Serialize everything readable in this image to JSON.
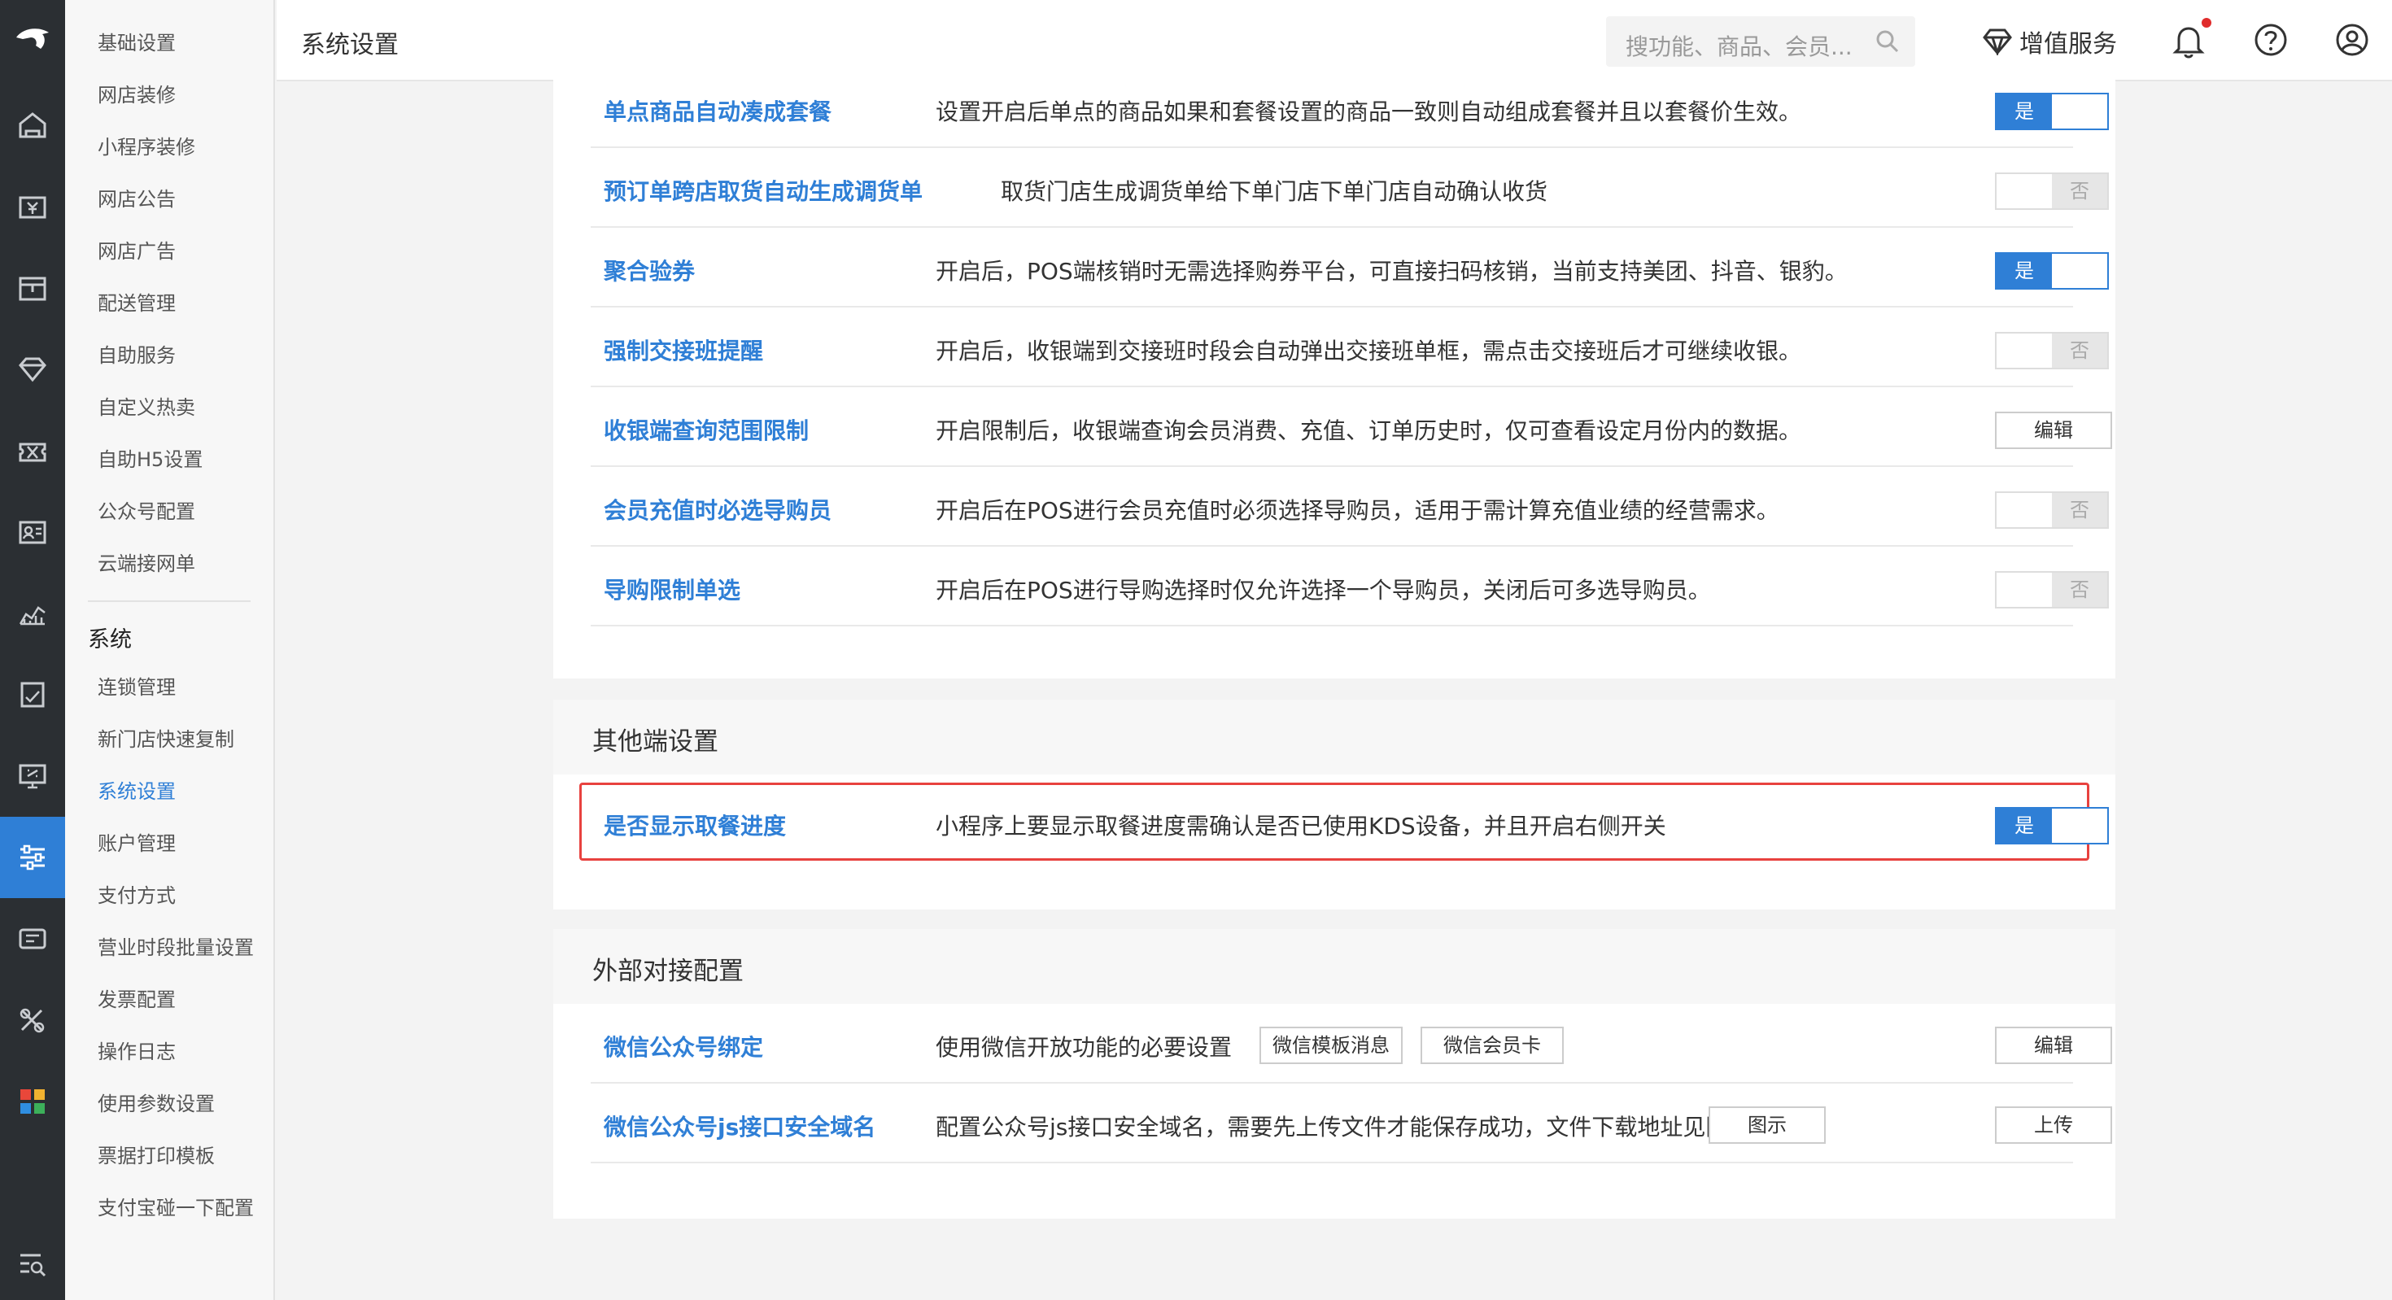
{
  "header": {
    "title": "系统设置",
    "search_placeholder": "搜功能、商品、会员...",
    "vip_label": "增值服务"
  },
  "submenu": {
    "items_top": [
      "基础设置",
      "网店装修",
      "小程序装修",
      "网店公告",
      "网店广告",
      "配送管理",
      "自助服务",
      "自定义热卖",
      "自助H5设置",
      "公众号配置",
      "云端接网单"
    ],
    "section_title": "系统",
    "items_bottom": [
      "连锁管理",
      "新门店快速复制",
      "系统设置",
      "账户管理",
      "支付方式",
      "营业时段批量设置",
      "发票配置",
      "操作日志",
      "使用参数设置",
      "票据打印模板",
      "支付宝碰一下配置"
    ],
    "active": "系统设置"
  },
  "rail_icons": [
    "logo-icon",
    "home-icon",
    "cashier-icon",
    "store-icon",
    "vip-icon",
    "coupon-icon",
    "member-card-icon",
    "analytics-icon",
    "report-icon",
    "monitor-icon",
    "settings-icon",
    "ticket-icon",
    "tools-icon",
    "apps-icon",
    "search-list-icon"
  ],
  "settings": [
    {
      "name": "单点商品自动凑成套餐",
      "desc": "设置开启后单点的商品如果和套餐设置的商品一致则自动组成套餐并且以套餐价生效。",
      "control": "toggle",
      "state": "是"
    },
    {
      "name": "预订单跨店取货自动生成调货单",
      "desc": "取货门店生成调货单给下单门店下单门店自动确认收货",
      "control": "toggle",
      "state": "否"
    },
    {
      "name": "聚合验券",
      "desc": "开启后，POS端核销时无需选择购券平台，可直接扫码核销，当前支持美团、抖音、银豹。",
      "control": "toggle",
      "state": "是"
    },
    {
      "name": "强制交接班提醒",
      "desc": "开启后，收银端到交接班时段会自动弹出交接班单框，需点击交接班后才可继续收银。",
      "control": "toggle",
      "state": "否"
    },
    {
      "name": "收银端查询范围限制",
      "desc": "开启限制后，收银端查询会员消费、充值、订单历史时，仅可查看设定月份内的数据。",
      "control": "button",
      "state": "编辑"
    },
    {
      "name": "会员充值时必选导购员",
      "desc": "开启后在POS进行会员充值时必须选择导购员，适用于需计算充值业绩的经营需求。",
      "control": "toggle",
      "state": "否"
    },
    {
      "name": "导购限制单选",
      "desc": "开启后在POS进行导购选择时仅允许选择一个导购员，关闭后可多选导购员。",
      "control": "toggle",
      "state": "否"
    }
  ],
  "other": {
    "title": "其他端设置",
    "row": {
      "name": "是否显示取餐进度",
      "desc": "小程序上要显示取餐进度需确认是否已使用KDS设备，并且开启右侧开关",
      "state": "是"
    }
  },
  "external": {
    "title": "外部对接配置",
    "rows": [
      {
        "name": "微信公众号绑定",
        "desc": "使用微信开放功能的必要设置",
        "tags": [
          "微信模板消息",
          "微信会员卡"
        ],
        "action": "编辑"
      },
      {
        "name": "微信公众号js接口安全域名",
        "desc": "配置公众号js接口安全域名，需要先上传文件才能保存成功，文件下载地址见图示",
        "tags": [
          "图示"
        ],
        "action": "上传"
      }
    ]
  },
  "colors": {
    "accent": "#2f7fd6",
    "sidebar": "#2b2f33",
    "highlight": "#e8423f"
  }
}
